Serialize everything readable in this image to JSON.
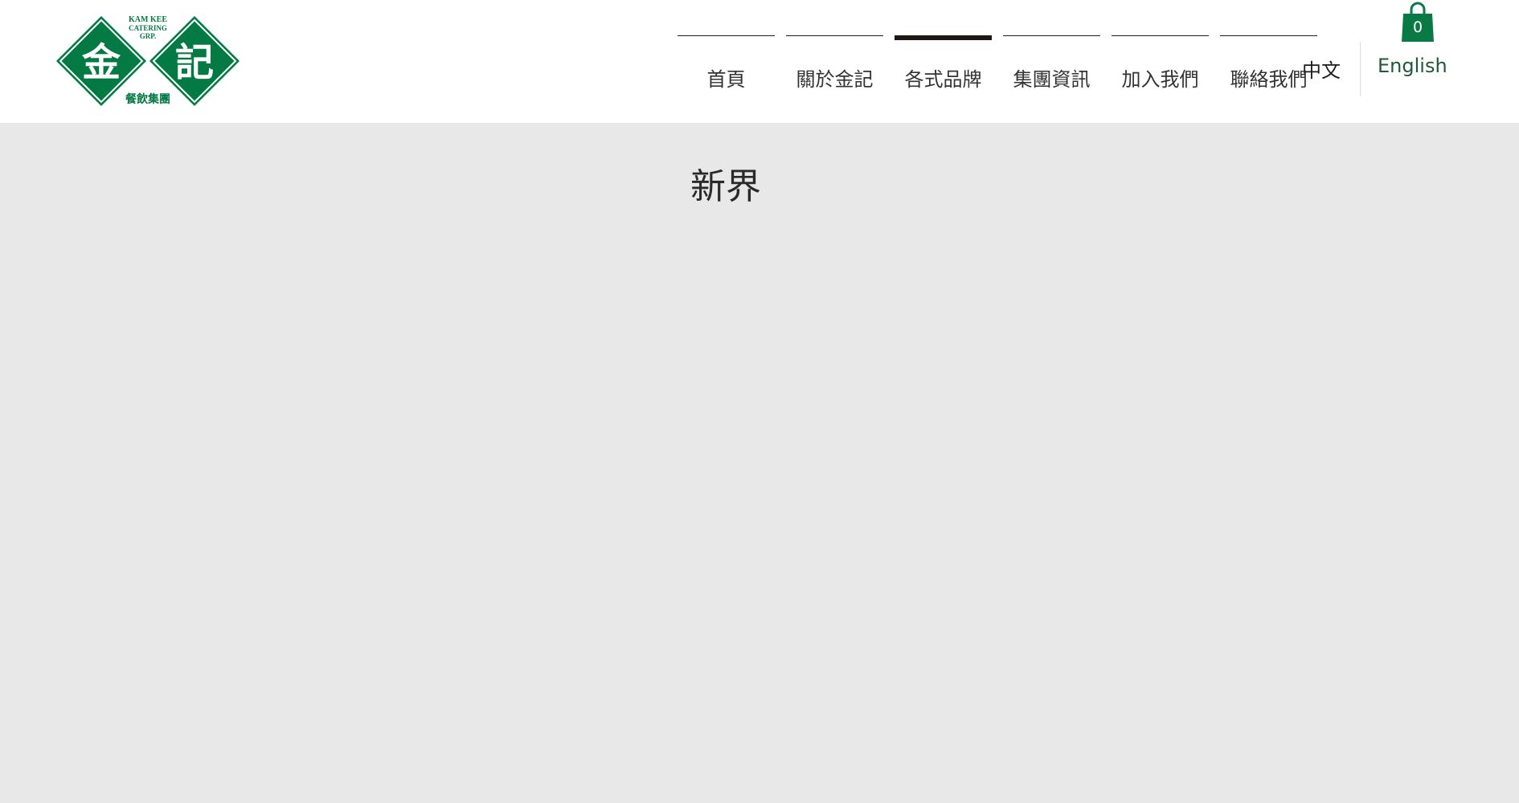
{
  "brand": {
    "name_en_line1": "KAM KEE",
    "name_en_line2": "CATERING",
    "name_en_line3": "GRP.",
    "char_left": "金",
    "char_right": "記",
    "tagline_zh": "餐飲集團",
    "color": "#037a43"
  },
  "nav": {
    "items": [
      {
        "label": "首頁",
        "active": false
      },
      {
        "label": "關於金記",
        "active": false
      },
      {
        "label": "各式品牌",
        "active": true
      },
      {
        "label": "集團資訊",
        "active": false
      },
      {
        "label": "加入我們",
        "active": false
      },
      {
        "label": "聯絡我們",
        "active": false
      }
    ]
  },
  "language": {
    "zh": "中文",
    "en": "English"
  },
  "cart": {
    "count": "0",
    "icon": "shopping-bag-icon",
    "color": "#0a7a45"
  },
  "page": {
    "title": "新界"
  }
}
